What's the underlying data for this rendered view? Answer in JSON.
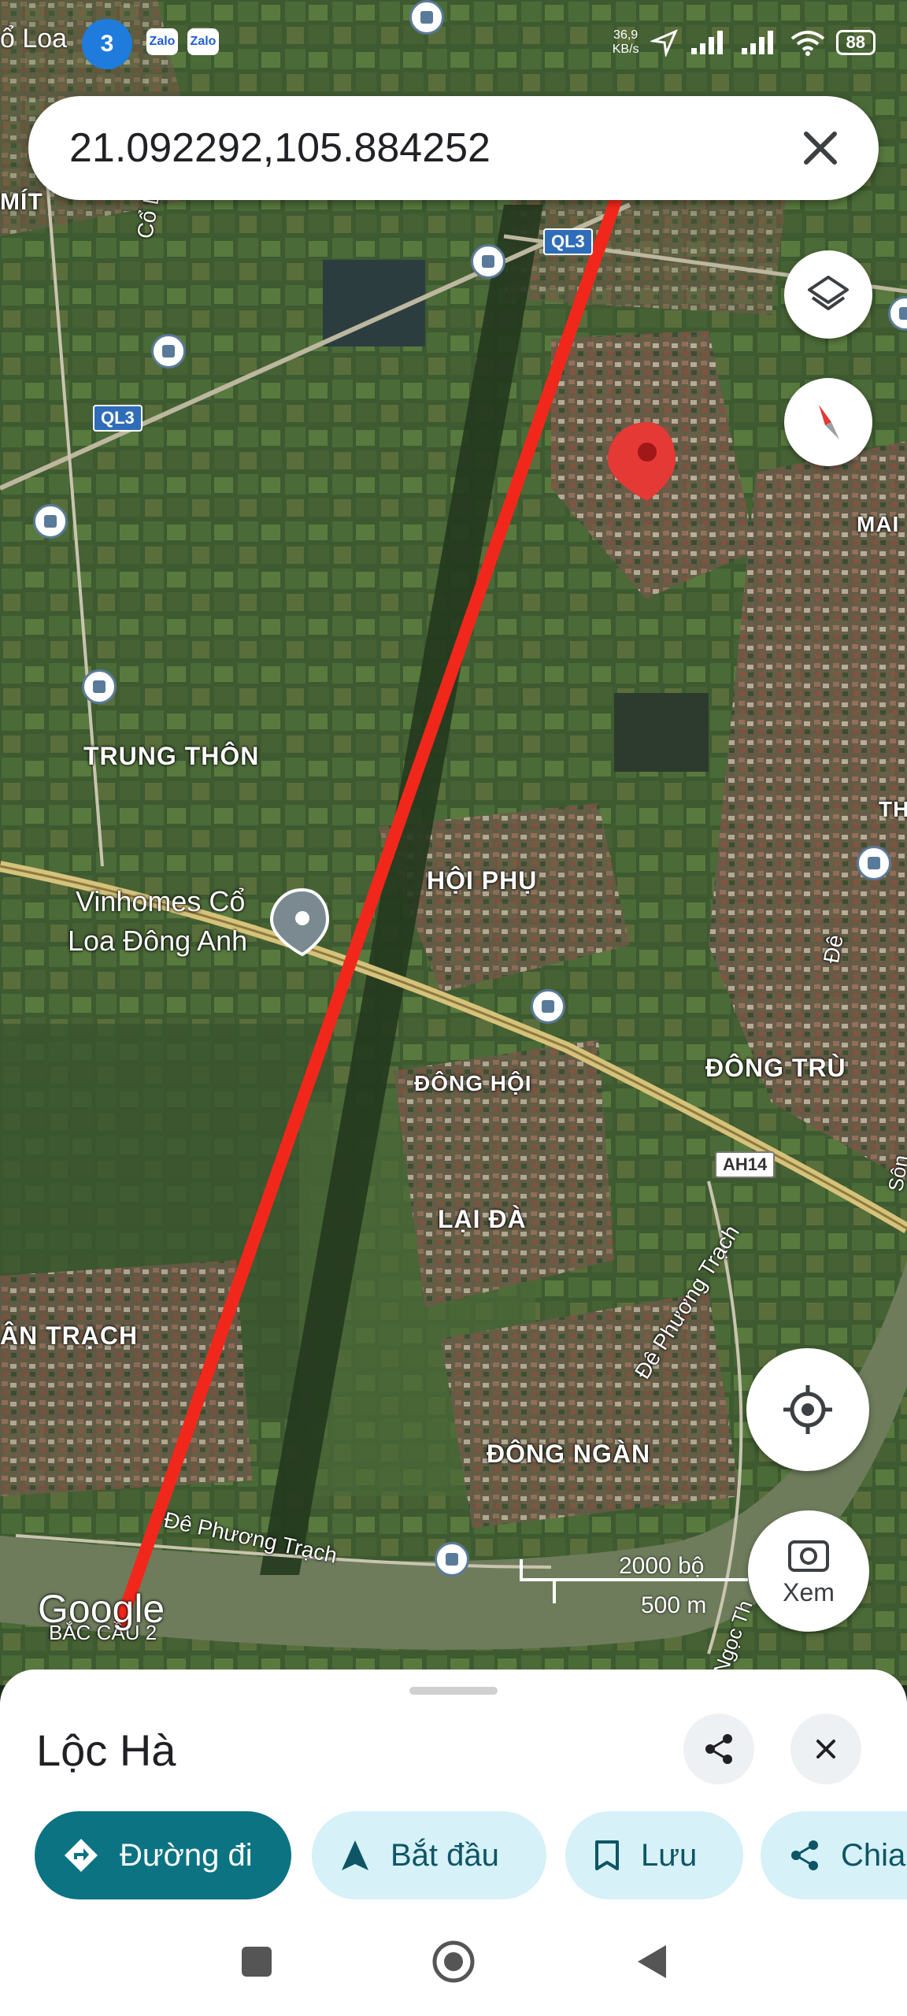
{
  "status_bar": {
    "carrier_fragment": "ổ Loa",
    "app_icons": [
      "3",
      "Zalo",
      "Zalo"
    ],
    "net_speed": "36,9",
    "net_speed_unit": "KB/s",
    "battery": "88"
  },
  "search": {
    "value": "21.092292,105.884252"
  },
  "map": {
    "labels": {
      "mit": "MÍT",
      "co_loa": "Cổ Loa",
      "trung_thon": "TRUNG THÔN",
      "hoi_phu": "HỘI PHỤ",
      "vinhomes_line1": "Vinhomes Cổ",
      "vinhomes_line2": "Loa Đông Anh",
      "dong_hoi": "ĐÔNG HỘI",
      "dong_tru": "ĐÔNG TRÙ",
      "lai_da": "LẠI ĐÀ",
      "an_trach": "ÂN TRẠCH",
      "dong_ngan": "ĐÔNG NGÀN",
      "de_phuong_trach_1": "Đê Phương Trạch",
      "de_phuong_trach_2": "Đê Phương Trạch",
      "mai": "MAI",
      "th": "TH",
      "de": "Đê",
      "song": "Sôn",
      "ngoc_th": "Ngọc Th",
      "bac_cau": "BẮC CẦU 2",
      "google": "Google"
    },
    "shields": {
      "ql3_top": "QL3",
      "ql3_left": "QL3",
      "ah14": "AH14"
    },
    "scale": {
      "imperial": "2000 bộ",
      "metric": "500 m"
    },
    "colors": {
      "pin": "#e53935",
      "measure_line": "#f2271b"
    }
  },
  "controls": {
    "layers_icon": "layers-icon",
    "compass_icon": "compass-icon",
    "location_icon": "my-location-icon",
    "view_label": "Xem"
  },
  "sheet": {
    "title": "Lộc Hà",
    "chips": [
      {
        "label": "Đường đi",
        "icon": "directions-icon"
      },
      {
        "label": "Bắt đầu",
        "icon": "navigation-arrow-icon"
      },
      {
        "label": "Lưu",
        "icon": "bookmark-icon"
      },
      {
        "label": "Chia",
        "icon": "share-icon"
      }
    ]
  },
  "nav": {
    "icons": [
      "recents-square-icon",
      "home-circle-icon",
      "back-triangle-icon"
    ]
  }
}
